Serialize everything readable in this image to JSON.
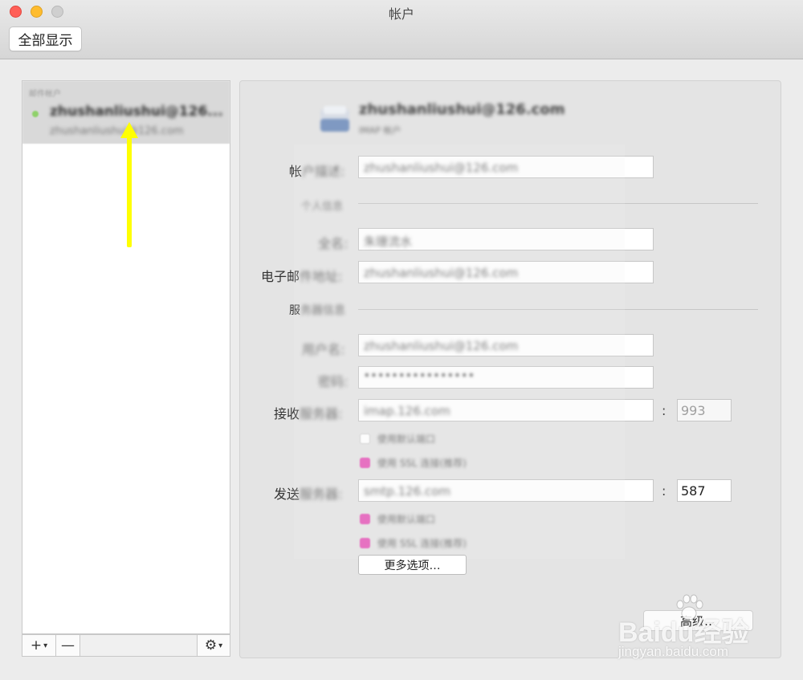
{
  "window": {
    "title": "帐户",
    "show_all": "全部显示"
  },
  "sidebar": {
    "group_label": "邮件帐户",
    "account_name": "zhushanliushui@126...",
    "account_sub": "zhushanliushui@126.com"
  },
  "sidebar_toolbar": {
    "add": "+",
    "remove": "—",
    "gear": "⚙"
  },
  "account": {
    "header_name": "zhushanliushui@126.com",
    "header_type": "IMAP 帐户",
    "description_label_prefix": "帐",
    "description_label_rest": "户描述:",
    "description_value": "zhushanliushui@126.com",
    "personal_section": "个人信息",
    "name_label": "全名:",
    "name_value": "朱珊流水",
    "email_label_prefix": "电子邮",
    "email_label_rest": "件地址:",
    "email_value": "zhushanliushui@126.com",
    "server_section_prefix": "服",
    "server_section_rest": "务器信息",
    "username_label": "用户名:",
    "username_value": "zhushanliushui@126.com",
    "password_label": "密码:",
    "password_value": "••••••••••••••••",
    "incoming_label_prefix": "接收",
    "incoming_label_rest": "服务器:",
    "incoming_value": "imap.126.com",
    "incoming_port": "993",
    "incoming_opt1": "使用默认端口",
    "incoming_opt2": "使用 SSL 连接(推荐)",
    "outgoing_label_prefix": "发送",
    "outgoing_label_rest": "服务器:",
    "outgoing_value": "smtp.126.com",
    "outgoing_port": "587",
    "outgoing_opt1": "使用默认端口",
    "outgoing_opt2": "使用 SSL 连接(推荐)",
    "colon": ":",
    "more_options": "更多选项…",
    "advanced": "高级…"
  },
  "watermark": {
    "main": "Baidu经验",
    "sub": "jingyan.baidu.com"
  },
  "colors": {
    "accent_checkbox": "#e456b8",
    "arrow": "#ffff00",
    "status_online": "#8fd16a"
  }
}
